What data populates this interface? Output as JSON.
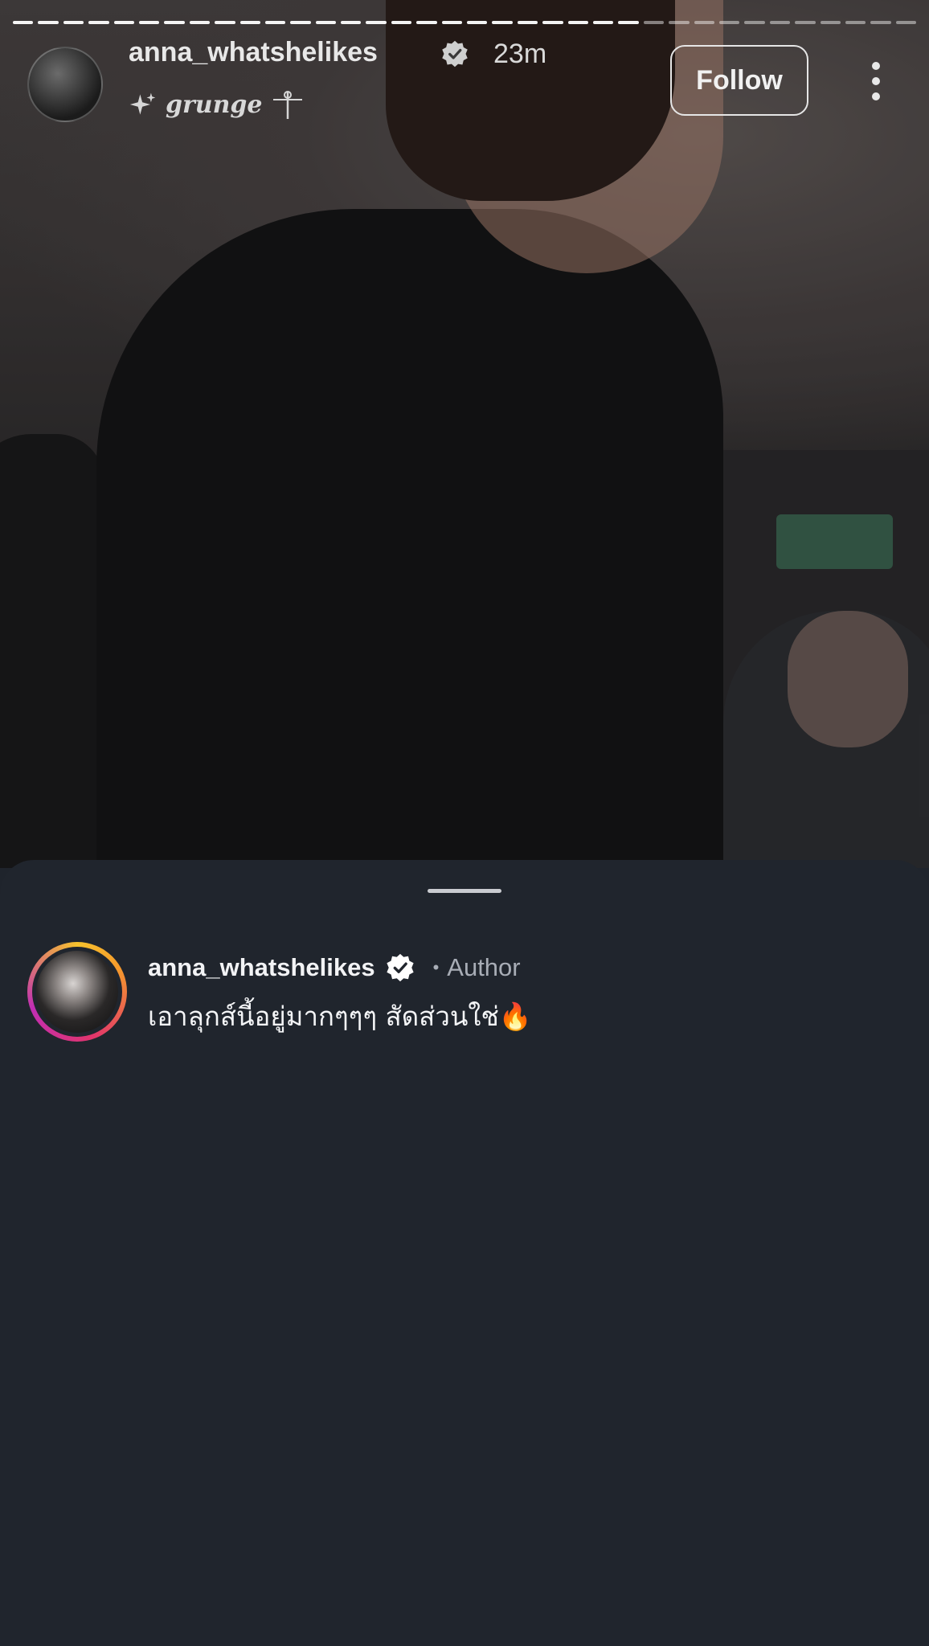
{
  "story": {
    "username": "anna_whatshelikes",
    "time": "23m",
    "subtitle": "grunge",
    "follow_label": "Follow",
    "progress": {
      "segments": 36,
      "viewed": 25
    }
  },
  "sheet": {
    "comment": {
      "username": "anna_whatshelikes",
      "dot": "•",
      "author_label": "Author",
      "text": "เอาลุกส์นี้อยู่มากๆๆๆ สัดส่วนใช่🔥"
    }
  },
  "colors": {
    "sheet_bg": "#20252d",
    "follow_border": "#e6e6e6",
    "ring_start": "#f6c22d",
    "ring_end": "#c02eb4",
    "muted_text": "#a8adb6"
  },
  "icons": [
    "verified-icon",
    "sparkle-icon",
    "dagger-icon",
    "more-icon"
  ]
}
